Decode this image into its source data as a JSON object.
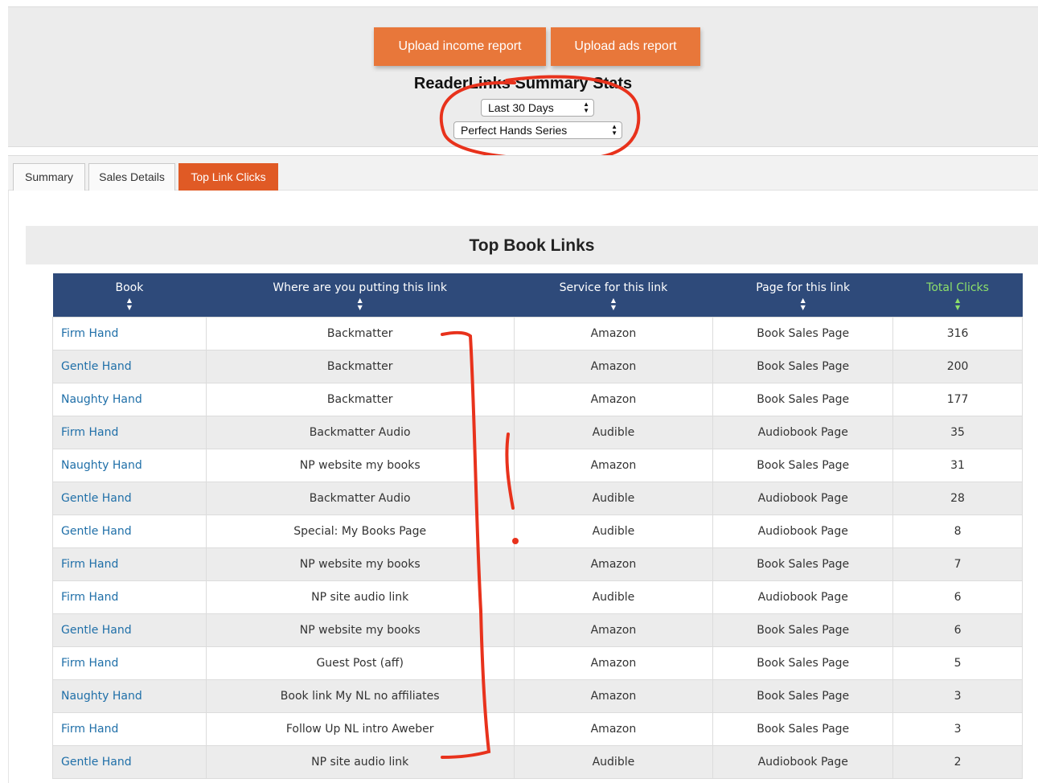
{
  "header": {
    "upload_income_label": "Upload income report",
    "upload_ads_label": "Upload ads report",
    "title": "ReaderLinks Summary Stats",
    "date_range": "Last 30 Days",
    "series": "Perfect Hands Series"
  },
  "tabs": [
    {
      "label": "Summary",
      "active": false
    },
    {
      "label": "Sales Details",
      "active": false
    },
    {
      "label": "Top Link Clicks",
      "active": true
    }
  ],
  "section_title": "Top Book Links",
  "table": {
    "columns": [
      "Book",
      "Where are you putting this link",
      "Service for this link",
      "Page for this link",
      "Total Clicks"
    ],
    "rows": [
      [
        "Firm Hand",
        "Backmatter",
        "Amazon",
        "Book Sales Page",
        "316"
      ],
      [
        "Gentle Hand",
        "Backmatter",
        "Amazon",
        "Book Sales Page",
        "200"
      ],
      [
        "Naughty Hand",
        "Backmatter",
        "Amazon",
        "Book Sales Page",
        "177"
      ],
      [
        "Firm Hand",
        "Backmatter Audio",
        "Audible",
        "Audiobook Page",
        "35"
      ],
      [
        "Naughty Hand",
        "NP website my books",
        "Amazon",
        "Book Sales Page",
        "31"
      ],
      [
        "Gentle Hand",
        "Backmatter Audio",
        "Audible",
        "Audiobook Page",
        "28"
      ],
      [
        "Gentle Hand",
        "Special: My Books Page",
        "Audible",
        "Audiobook Page",
        "8"
      ],
      [
        "Firm Hand",
        "NP website my books",
        "Amazon",
        "Book Sales Page",
        "7"
      ],
      [
        "Firm Hand",
        "NP site audio link",
        "Audible",
        "Audiobook Page",
        "6"
      ],
      [
        "Gentle Hand",
        "NP website my books",
        "Amazon",
        "Book Sales Page",
        "6"
      ],
      [
        "Firm Hand",
        "Guest Post (aff)",
        "Amazon",
        "Book Sales Page",
        "5"
      ],
      [
        "Naughty Hand",
        "Book link My NL no affiliates",
        "Amazon",
        "Book Sales Page",
        "3"
      ],
      [
        "Firm Hand",
        "Follow Up NL intro Aweber",
        "Amazon",
        "Book Sales Page",
        "3"
      ],
      [
        "Gentle Hand",
        "NP site audio link",
        "Audible",
        "Audiobook Page",
        "2"
      ]
    ]
  },
  "colors": {
    "button": "#e8773a",
    "active_tab": "#e05a25",
    "table_header": "#2e4a7a",
    "total_clicks_header": "#8de06a",
    "book_link": "#1f6fa8",
    "annotation": "#e8321c"
  },
  "icons": {
    "sort": "sort-arrows-icon",
    "select": "select-arrows-icon"
  }
}
